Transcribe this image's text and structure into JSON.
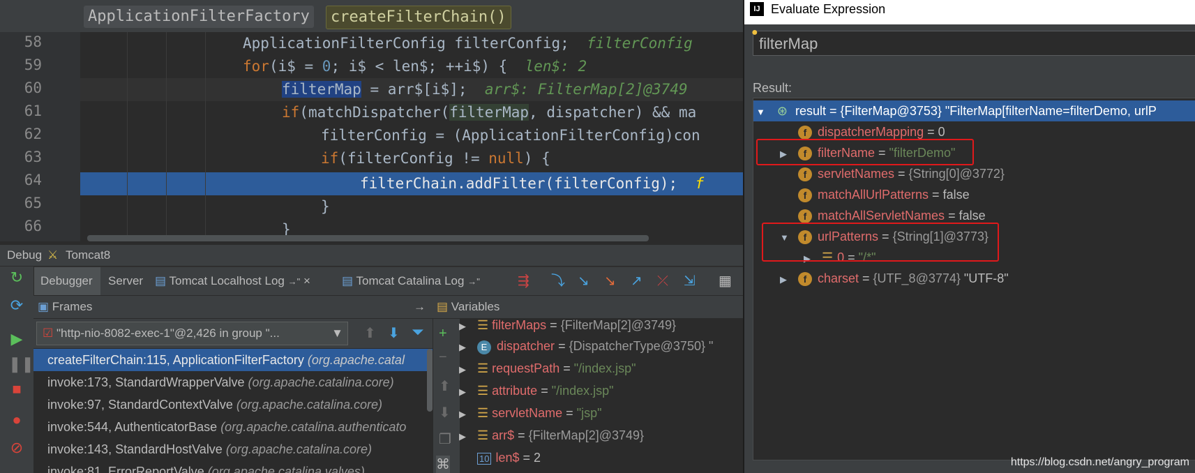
{
  "editor": {
    "breadcrumb": {
      "class_name": "ApplicationFilterFactory",
      "method_name": "createFilterChain()"
    },
    "lines": [
      {
        "no": "58"
      },
      {
        "no": "59"
      },
      {
        "no": "60"
      },
      {
        "no": "61"
      },
      {
        "no": "62"
      },
      {
        "no": "63"
      },
      {
        "no": "64"
      },
      {
        "no": "65"
      },
      {
        "no": "66"
      }
    ],
    "code": {
      "l58_a": "ApplicationFilterConfig filterConfig;",
      "l58_hint": "filterConfig",
      "l59_kw": "for",
      "l59_a": "(i$ = ",
      "l59_num": "0",
      "l59_b": "; i$ < len$; ++i$) {",
      "l59_hint": "len$: 2",
      "l60_var": "filterMap",
      "l60_a": " = arr$[i$];",
      "l60_hint": "arr$: FilterMap[2]@3749",
      "l61_kw": "if",
      "l61_a": "(matchDispatcher(",
      "l61_occ": "filterMap",
      "l61_b": ", dispatcher) && ma",
      "l62_a": "filterConfig = (ApplicationFilterConfig)con",
      "l63_kw": "if",
      "l63_a": "(filterConfig != ",
      "l63_kw2": "null",
      "l63_b": ") {",
      "l64_a": "filterChain.addFilter(filterConfig);",
      "l64_hint": "f",
      "l65_a": "}",
      "l66_a": "}"
    }
  },
  "debug": {
    "title": "Debug",
    "config": "Tomcat8",
    "tabs": [
      "Debugger",
      "Server",
      "Tomcat Localhost Log",
      "Tomcat Catalina Log"
    ],
    "tab_pin": "→\"",
    "tab_close": "×",
    "frames_title": "Frames",
    "variables_title": "Variables",
    "thread": "\"http-nio-8082-exec-1\"@2,426 in group \"...",
    "frames": [
      {
        "method": "createFilterChain:115, ApplicationFilterFactory",
        "pkg": "(org.apache.catal"
      },
      {
        "method": "invoke:173, StandardWrapperValve",
        "pkg": "(org.apache.catalina.core)"
      },
      {
        "method": "invoke:97, StandardContextValve",
        "pkg": "(org.apache.catalina.core)"
      },
      {
        "method": "invoke:544, AuthenticatorBase",
        "pkg": "(org.apache.catalina.authenticato"
      },
      {
        "method": "invoke:143, StandardHostValve",
        "pkg": "(org.apache.catalina.core)"
      },
      {
        "method": "invoke:81, ErrorReportValve",
        "pkg": "(org.apache.catalina.valves)"
      }
    ],
    "variables": [
      {
        "name": "filterMaps",
        "eq": " = ",
        "val": "{FilterMap[2]@3749}"
      },
      {
        "name": "dispatcher",
        "eq": " = ",
        "val": "{DispatcherType@3750} \""
      },
      {
        "name": "requestPath",
        "eq": " = ",
        "val": "\"/index.jsp\""
      },
      {
        "name": "attribute",
        "eq": " = ",
        "val": "\"/index.jsp\""
      },
      {
        "name": "servletName",
        "eq": " = ",
        "val": "\"jsp\""
      },
      {
        "name": "arr$",
        "eq": " = ",
        "val": "{FilterMap[2]@3749}"
      },
      {
        "name": "len$",
        "eq": " = ",
        "val": "2"
      }
    ]
  },
  "dialog": {
    "title": "Evaluate Expression",
    "expression": "filterMap",
    "result_label": "Result:",
    "root": "result = {FilterMap@3753} \"FilterMap[filterName=filterDemo, urlP",
    "fields": {
      "dispatcherMapping": {
        "name": "dispatcherMapping",
        "eq": " = ",
        "val": "0"
      },
      "filterName": {
        "name": "filterName",
        "eq": " = ",
        "val": "\"filterDemo\""
      },
      "servletNames": {
        "name": "servletNames",
        "eq": " = ",
        "val": "{String[0]@3772}"
      },
      "matchAllUrlPatterns": {
        "name": "matchAllUrlPatterns",
        "eq": " = ",
        "val": "false"
      },
      "matchAllServletNames": {
        "name": "matchAllServletNames",
        "eq": " = ",
        "val": "false"
      },
      "urlPatterns": {
        "name": "urlPatterns",
        "eq": " = ",
        "val": "{String[1]@3773}"
      },
      "urlPattern0": {
        "name": "0",
        "eq": " = ",
        "val": "\"/*\""
      },
      "charset": {
        "name": "charset",
        "eq": " = ",
        "val": "{UTF_8@3774}",
        "val2": " \"UTF-8\""
      }
    }
  },
  "watermark": "https://blog.csdn.net/angry_program",
  "colors": {
    "selection": "#2d5c9a",
    "keyword": "#cc7832",
    "hint": "#629755",
    "field_name": "#e06c6c",
    "red_box": "#e0191b"
  }
}
